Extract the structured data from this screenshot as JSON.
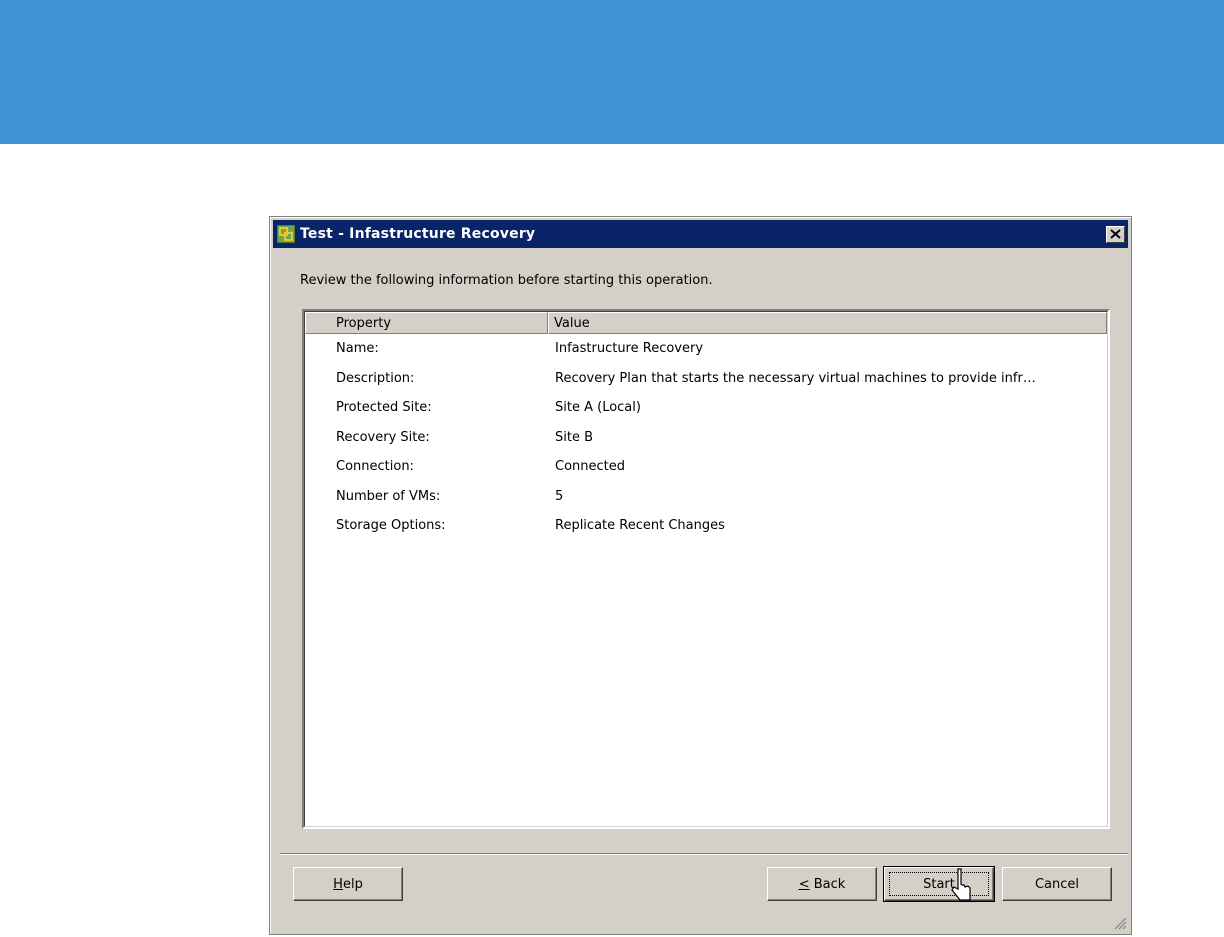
{
  "dialog": {
    "title": "Test - Infastructure Recovery",
    "intro": "Review the following information before starting this operation."
  },
  "table": {
    "columns": [
      "Property",
      "Value"
    ],
    "rows": [
      {
        "property": "Name:",
        "value": "Infastructure Recovery"
      },
      {
        "property": "Description:",
        "value": "Recovery Plan that starts the necessary virtual machines to provide infr…"
      },
      {
        "property": "Protected Site:",
        "value": "Site A (Local)"
      },
      {
        "property": "Recovery Site:",
        "value": "Site B"
      },
      {
        "property": "Connection:",
        "value": "Connected"
      },
      {
        "property": "Number of VMs:",
        "value": "5"
      },
      {
        "property": "Storage Options:",
        "value": "Replicate Recent Changes"
      }
    ]
  },
  "buttons": {
    "help_mnemonic": "H",
    "help_rest": "elp",
    "back_mnemonic": "<",
    "back_rest": " Back",
    "start": "Start",
    "cancel": "Cancel"
  },
  "icons": {
    "app": "vsphere-app-icon",
    "close": "close-icon",
    "grip": "resize-grip-icon",
    "cursor": "mouse-pointer-icon"
  },
  "colors": {
    "banner": "#4094d8",
    "titlebar": "#0a246a",
    "dialog_bg": "#d4d0c8"
  }
}
